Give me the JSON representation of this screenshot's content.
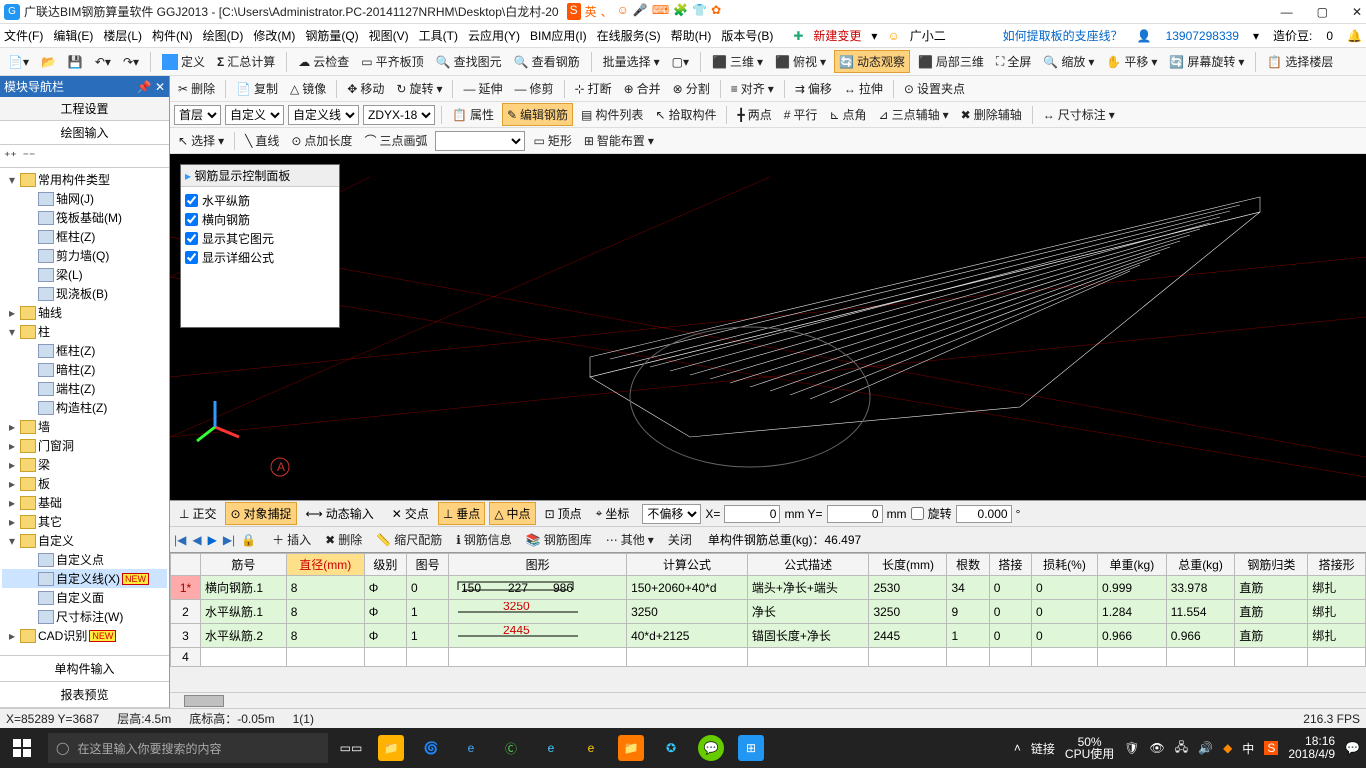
{
  "title": "广联达BIM钢筋算量软件 GGJ2013 - [C:\\Users\\Administrator.PC-20141127NRHM\\Desktop\\白龙村-20",
  "ime_glyphs": [
    "英",
    "、",
    "☺",
    "🎤",
    "⌨",
    "🧩",
    "👕",
    "✿"
  ],
  "menu": [
    "文件(F)",
    "编辑(E)",
    "楼层(L)",
    "构件(N)",
    "绘图(D)",
    "修改(M)",
    "钢筋量(Q)",
    "视图(V)",
    "工具(T)",
    "云应用(Y)",
    "BIM应用(I)",
    "在线服务(S)",
    "帮助(H)",
    "版本号(B)"
  ],
  "menu_right": {
    "newchange": "新建变更",
    "assistant": "广小二",
    "hint": "如何提取板的支座线？",
    "phone": "13907298339",
    "credit_label": "造价豆:",
    "credit": "0"
  },
  "toolbar_main": {
    "define": "定义",
    "sum": "汇总计算",
    "cloud": "云检查",
    "flat": "平齐板顶",
    "find": "查找图元",
    "viewrebar": "查看钢筋",
    "batch": "批量选择",
    "view3d": "三维",
    "topview": "俯视",
    "dynamic": "动态观察",
    "local3d": "局部三维",
    "fullscreen": "全屏",
    "zoom": "缩放",
    "pan": "平移",
    "screenrotate": "屏幕旋转",
    "choosefloor": "选择楼层"
  },
  "toolbar_edit": {
    "delete": "删除",
    "copy": "复制",
    "mirror": "镜像",
    "move": "移动",
    "rotate": "旋转",
    "extend": "延伸",
    "trim": "修剪",
    "break": "打断",
    "merge": "合并",
    "split": "分割",
    "align": "对齐",
    "offset": "偏移",
    "stretch": "拉伸",
    "setpoint": "设置夹点"
  },
  "toolbar_floor": {
    "floor": "首层",
    "layer": "自定义",
    "linedef": "自定义线",
    "code": "ZDYX-18",
    "attr": "属性",
    "editrebar": "编辑钢筋",
    "complist": "构件列表",
    "pick": "拾取构件",
    "twopoint": "两点",
    "parallel": "平行",
    "pointangle": "点角",
    "threeaux": "三点辅轴",
    "delaux": "删除辅轴",
    "dim": "尺寸标注"
  },
  "toolbar_draw": {
    "select": "选择",
    "line": "直线",
    "ptlen": "点加长度",
    "arc": "三点画弧",
    "rect": "矩形",
    "smart": "智能布置"
  },
  "leftpanel": {
    "header": "模块导航栏",
    "tabs": [
      "工程设置",
      "绘图输入"
    ],
    "nodes": [
      {
        "ind": 0,
        "exp": "▾",
        "ico": "folder",
        "label": "常用构件类型"
      },
      {
        "ind": 1,
        "exp": "",
        "ico": "leaf",
        "label": "轴网(J)"
      },
      {
        "ind": 1,
        "exp": "",
        "ico": "leaf",
        "label": "筏板基础(M)"
      },
      {
        "ind": 1,
        "exp": "",
        "ico": "leaf",
        "label": "框柱(Z)"
      },
      {
        "ind": 1,
        "exp": "",
        "ico": "leaf",
        "label": "剪力墙(Q)"
      },
      {
        "ind": 1,
        "exp": "",
        "ico": "leaf",
        "label": "梁(L)"
      },
      {
        "ind": 1,
        "exp": "",
        "ico": "leaf",
        "label": "现浇板(B)"
      },
      {
        "ind": 0,
        "exp": "▸",
        "ico": "folder",
        "label": "轴线"
      },
      {
        "ind": 0,
        "exp": "▾",
        "ico": "folder",
        "label": "柱"
      },
      {
        "ind": 1,
        "exp": "",
        "ico": "leaf",
        "label": "框柱(Z)"
      },
      {
        "ind": 1,
        "exp": "",
        "ico": "leaf",
        "label": "暗柱(Z)"
      },
      {
        "ind": 1,
        "exp": "",
        "ico": "leaf",
        "label": "端柱(Z)"
      },
      {
        "ind": 1,
        "exp": "",
        "ico": "leaf",
        "label": "构造柱(Z)"
      },
      {
        "ind": 0,
        "exp": "▸",
        "ico": "folder",
        "label": "墙"
      },
      {
        "ind": 0,
        "exp": "▸",
        "ico": "folder",
        "label": "门窗洞"
      },
      {
        "ind": 0,
        "exp": "▸",
        "ico": "folder",
        "label": "梁"
      },
      {
        "ind": 0,
        "exp": "▸",
        "ico": "folder",
        "label": "板"
      },
      {
        "ind": 0,
        "exp": "▸",
        "ico": "folder",
        "label": "基础"
      },
      {
        "ind": 0,
        "exp": "▸",
        "ico": "folder",
        "label": "其它"
      },
      {
        "ind": 0,
        "exp": "▾",
        "ico": "folder",
        "label": "自定义"
      },
      {
        "ind": 1,
        "exp": "",
        "ico": "leaf",
        "label": "自定义点"
      },
      {
        "ind": 1,
        "exp": "",
        "ico": "leaf",
        "label": "自定义线(X)",
        "sel": true,
        "new": true
      },
      {
        "ind": 1,
        "exp": "",
        "ico": "leaf",
        "label": "自定义面"
      },
      {
        "ind": 1,
        "exp": "",
        "ico": "leaf",
        "label": "尺寸标注(W)"
      },
      {
        "ind": 0,
        "exp": "▸",
        "ico": "folder",
        "label": "CAD识别",
        "new": true
      }
    ],
    "bottom": [
      "单构件输入",
      "报表预览"
    ]
  },
  "ctrlpanel": {
    "title": "钢筋显示控制面板",
    "items": [
      "水平纵筋",
      "横向钢筋",
      "显示其它图元",
      "显示详细公式"
    ]
  },
  "snapbar": {
    "ortho": "正交",
    "obj": "对象捕捉",
    "dyn": "动态输入",
    "cross": "交点",
    "perp": "垂点",
    "mid": "中点",
    "vertex": "顶点",
    "coord": "坐标",
    "noffset": "不偏移",
    "x": "0",
    "xunit": "mm  Y=",
    "y": "0",
    "yunit": "mm",
    "rotlabel": "旋转",
    "rotval": "0.000"
  },
  "rebarbar": {
    "insert": "插入",
    "delete": "删除",
    "scale": "缩尺配筋",
    "info": "钢筋信息",
    "lib": "钢筋图库",
    "other": "其他",
    "close": "关闭",
    "total": "单构件钢筋总重(kg)：46.497"
  },
  "grid": {
    "headers": [
      "筋号",
      "直径(mm)",
      "级别",
      "图号",
      "图形",
      "计算公式",
      "公式描述",
      "长度(mm)",
      "根数",
      "搭接",
      "损耗(%)",
      "单重(kg)",
      "总重(kg)",
      "钢筋归类",
      "搭接形"
    ],
    "rows": [
      {
        "idx": "1*",
        "vals": [
          "横向钢筋.1",
          "8",
          "Φ",
          "0",
          "",
          "150+2060+40*d",
          "端头+净长+端头",
          "2530",
          "34",
          "0",
          "0",
          "0.999",
          "33.978",
          "直筋",
          "绑扎"
        ],
        "shape": "hook"
      },
      {
        "idx": "2",
        "vals": [
          "水平纵筋.1",
          "8",
          "Φ",
          "1",
          "",
          "3250",
          "净长",
          "3250",
          "9",
          "0",
          "0",
          "1.284",
          "11.554",
          "直筋",
          "绑扎"
        ],
        "shape": "3250"
      },
      {
        "idx": "3",
        "vals": [
          "水平纵筋.2",
          "8",
          "Φ",
          "1",
          "",
          "40*d+2125",
          "锚固长度+净长",
          "2445",
          "1",
          "0",
          "0",
          "0.966",
          "0.966",
          "直筋",
          "绑扎"
        ],
        "shape": "2445"
      },
      {
        "idx": "4",
        "vals": [
          "",
          "",
          "",
          "",
          "",
          "",
          "",
          "",
          "",
          "",
          "",
          "",
          "",
          "",
          ""
        ],
        "empty": true
      }
    ]
  },
  "status": {
    "xy": "X=85289 Y=3687",
    "floor": "层高:4.5m",
    "base": "底标高：-0.05m",
    "sel": "1(1)",
    "fps": "216.3 FPS"
  },
  "taskbar": {
    "search": "在这里输入你要搜索的内容",
    "cpu": "50%\nCPU使用",
    "link": "链接",
    "time": "18:16",
    "date": "2018/4/9",
    "ch": "中"
  }
}
